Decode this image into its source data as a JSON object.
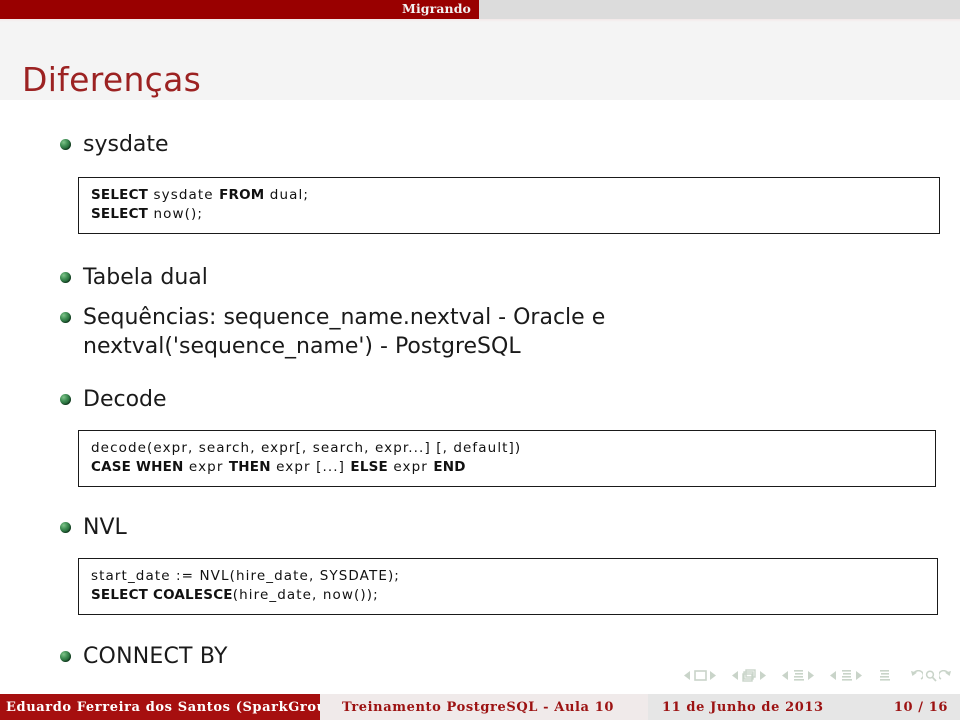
{
  "header": {
    "section_title": "Migrando",
    "frame_title": "Diferenças",
    "bar_color": "#990000",
    "title_color": "#9c2222"
  },
  "content": {
    "items": [
      {
        "label": "sysdate",
        "code": [
          [
            {
              "t": "SELECT",
              "b": true
            },
            {
              "t": " sysdate ",
              "b": false
            },
            {
              "t": "FROM",
              "b": true
            },
            {
              "t": " dual;",
              "b": false
            }
          ],
          [
            {
              "t": "SELECT",
              "b": true
            },
            {
              "t": " now();",
              "b": false
            }
          ]
        ]
      },
      {
        "label": "Tabela dual",
        "code": null
      },
      {
        "label": "Sequências: sequence_name.nextval - Oracle e\nnextval('sequence_name') - PostgreSQL",
        "code": null
      },
      {
        "label": "Decode",
        "code": [
          [
            {
              "t": "decode(expr, search, expr[, search, expr...] [, default])",
              "b": false
            }
          ],
          [
            {
              "t": "CASE WHEN",
              "b": true
            },
            {
              "t": " expr ",
              "b": false
            },
            {
              "t": "THEN",
              "b": true
            },
            {
              "t": " expr [...] ",
              "b": false
            },
            {
              "t": "ELSE",
              "b": true
            },
            {
              "t": " expr ",
              "b": false
            },
            {
              "t": "END",
              "b": true
            }
          ]
        ]
      },
      {
        "label": "NVL",
        "code": [
          [
            {
              "t": "start_date := NVL(hire_date, SYSDATE);",
              "b": false
            }
          ],
          [
            {
              "t": "SELECT COALESCE",
              "b": true
            },
            {
              "t": "(hire_date, now());",
              "b": false
            }
          ]
        ]
      },
      {
        "label": "CONNECT BY",
        "code": null
      }
    ]
  },
  "navigation": {
    "symbols": [
      "slide-prev-icon",
      "slide-icon",
      "slide-next-icon",
      "frame-prev-icon",
      "frame-icon",
      "frame-next-icon",
      "subsection-prev-icon",
      "subsection-icon",
      "subsection-next-icon",
      "section-prev-icon",
      "section-icon",
      "section-next-icon",
      "presentation-icon",
      "back-icon",
      "search-icon",
      "forward-icon"
    ]
  },
  "footer": {
    "author": "Eduardo Ferreira dos Santos (SparkGroup",
    "title": "Treinamento PostgreSQL - Aula 10",
    "date": "11 de Junho de 2013",
    "page": "10 / 16",
    "bg_author": "#a60f0f",
    "fg_text": "#9c1212"
  }
}
